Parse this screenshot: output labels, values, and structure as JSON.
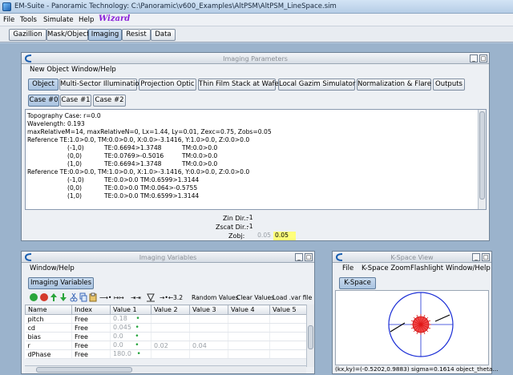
{
  "window": {
    "title": "EM-Suite - Panoramic Technology: C:\\Panoramic\\v600_Examples\\AltPSM\\AltPSM_LineSpace.sim"
  },
  "menubar": {
    "file": "File",
    "tools": "Tools",
    "simulate": "Simulate",
    "help": "Help",
    "wizard": "Wizard"
  },
  "main_tabs": [
    "Gazillion",
    "Mask/Object",
    "Imaging",
    "Resist",
    "Data"
  ],
  "imaging_parameters": {
    "title": "Imaging Parameters",
    "menu": [
      "New Object",
      "Window/Help"
    ],
    "tabs": [
      "Object",
      "Multi-Sector Illumination",
      "Projection Optic",
      "Thin Film Stack at Wafer",
      "Local Gazim Simulator",
      "Normalization & Flare",
      "Outputs"
    ],
    "case_tabs": [
      "Case #0",
      "Case #1",
      "Case #2"
    ],
    "lines": [
      "Topography Case: r=0.0",
      "Wavelength: 0.193",
      "maxRelativeM=14, maxRelativeN=0, Lx=1.44, Ly=0.01, Zexc=0.75, Zobs=0.05",
      "Reference TE:1.0>0.0, TM:0.0>0.0, X:0.0>-3.1416, Y:1.0>0.0, Z:0.0>0.0"
    ],
    "te_rows": [
      {
        "mn": "(-1,0)",
        "te": "TE:0.6694>1.3748",
        "tm": "TM:0.0>0.0"
      },
      {
        "mn": "(0,0)",
        "te": "TE:0.0769>-0.5016",
        "tm": "TM:0.0>0.0"
      },
      {
        "mn": "(1,0)",
        "te": "TE:0.6694>1.3748",
        "tm": "TM:0.0>0.0"
      }
    ],
    "reference_tm": "Reference TE:0.0>0.0, TM:1.0>0.0, X:1.0>-3.1416, Y:0.0>0.0, Z:0.0>0.0",
    "tm_rows": [
      {
        "mn": "(-1,0)",
        "te": "TE:0.0>0.0",
        "tm": "TM:0.6599>1.3144"
      },
      {
        "mn": "(0,0)",
        "te": "TE:0.0>0.0",
        "tm": "TM:0.064>-0.5755"
      },
      {
        "mn": "(1,0)",
        "te": "TE:0.0>0.0",
        "tm": "TM:0.6599>1.3144"
      }
    ],
    "zin_label": "Zin Dir.:",
    "zin_value": "-1",
    "zscat_label": "Zscat Dir.:",
    "zscat_value": "-1",
    "zobj_label": "Zobj:",
    "zobj_value_1": "0.05",
    "zobj_value_2": "0.05"
  },
  "imaging_variables": {
    "title": "Imaging Variables",
    "menu": [
      "Window/Help"
    ],
    "tab": "Imaging Variables",
    "toolbar": {
      "random_values": "Random Values",
      "clear_values": "Clear Values",
      "load_var": "Load .var file",
      "precision": "3.2"
    },
    "columns": [
      "Name",
      "Index",
      "Value 1",
      "Value 2",
      "Value 3",
      "Value 4",
      "Value 5"
    ],
    "rows": [
      {
        "name": "pitch",
        "index": "Free",
        "v1": "0.18",
        "dot": "•",
        "v2": "",
        "v3": ""
      },
      {
        "name": "cd",
        "index": "Free",
        "v1": "0.045",
        "dot": "•",
        "v2": "",
        "v3": ""
      },
      {
        "name": "bias",
        "index": "Free",
        "v1": "0.0",
        "dot": "•",
        "v2": "",
        "v3": ""
      },
      {
        "name": "r",
        "index": "Free",
        "v1": "0.0",
        "dot": "•",
        "v2": "0.02",
        "v3": "0.04"
      },
      {
        "name": "dPhase",
        "index": "Free",
        "v1": "180.0",
        "dot": "•",
        "v2": "",
        "v3": ""
      }
    ]
  },
  "kspace_view": {
    "title": "K-Space View",
    "menu": [
      "File",
      "K-Space Zoom",
      "Flashlight",
      "Window/Help"
    ],
    "tab": "K-Space",
    "status": "(kx,ky)=(-0.5202,0.9883) sigma=0.1614 object_theta..."
  },
  "colors": {
    "accent": "#1a5fb0",
    "wizard": "#8b1fd8",
    "zobj_field": "#ffff7a",
    "kspace_circle": "#1c2fd6",
    "kspace_spot": "#e01818"
  }
}
